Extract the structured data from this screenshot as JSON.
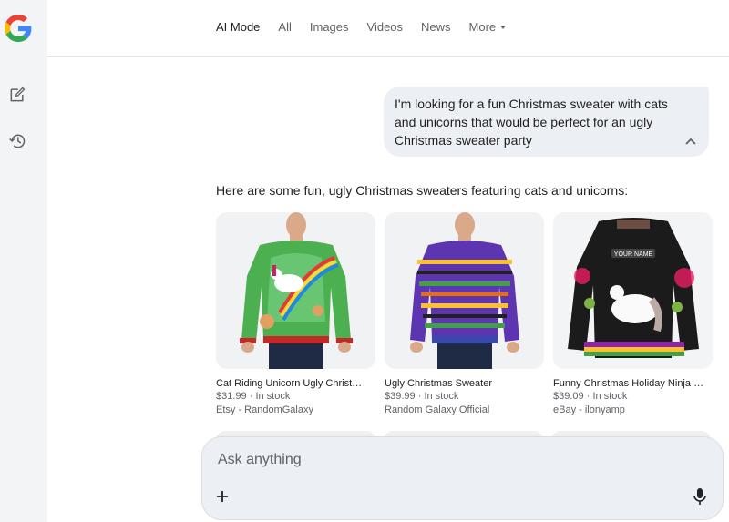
{
  "header": {
    "tabs": [
      {
        "label": "AI Mode",
        "active": true
      },
      {
        "label": "All"
      },
      {
        "label": "Images"
      },
      {
        "label": "Videos"
      },
      {
        "label": "News"
      },
      {
        "label": "More"
      }
    ]
  },
  "sidebar": {
    "logo_icon": "google-g-icon",
    "items": [
      {
        "icon": "edit-icon"
      },
      {
        "icon": "history-icon"
      }
    ]
  },
  "conversation": {
    "user_message": "I'm looking for a fun Christmas sweater with cats and unicorns that would be perfect for an ugly Christmas sweater party",
    "answer_intro": "Here are some fun, ugly Christmas sweaters featuring cats and unicorns:"
  },
  "products": [
    {
      "title": "Cat Riding Unicorn Ugly Christmas Sweater",
      "price": "$31.99",
      "stock": "In stock",
      "seller": "Etsy - RandomGalaxy"
    },
    {
      "title": "Ugly Christmas Sweater",
      "price": "$39.99",
      "stock": "In stock",
      "seller": "Random Galaxy Official"
    },
    {
      "title": "Funny Christmas Holiday Ninja Cat Unicorn Sweater",
      "price": "$39.09",
      "stock": "In stock",
      "seller": "eBay - ilonyamp"
    }
  ],
  "composer": {
    "placeholder": "Ask anything",
    "plus_icon": "plus-icon",
    "mic_icon": "mic-icon"
  },
  "colors": {
    "google_blue": "#4285F4",
    "google_red": "#EA4335",
    "google_yellow": "#FBBC05",
    "google_green": "#34A853",
    "rail_bg": "#f3f4f6",
    "bubble_bg": "#eceff4"
  }
}
